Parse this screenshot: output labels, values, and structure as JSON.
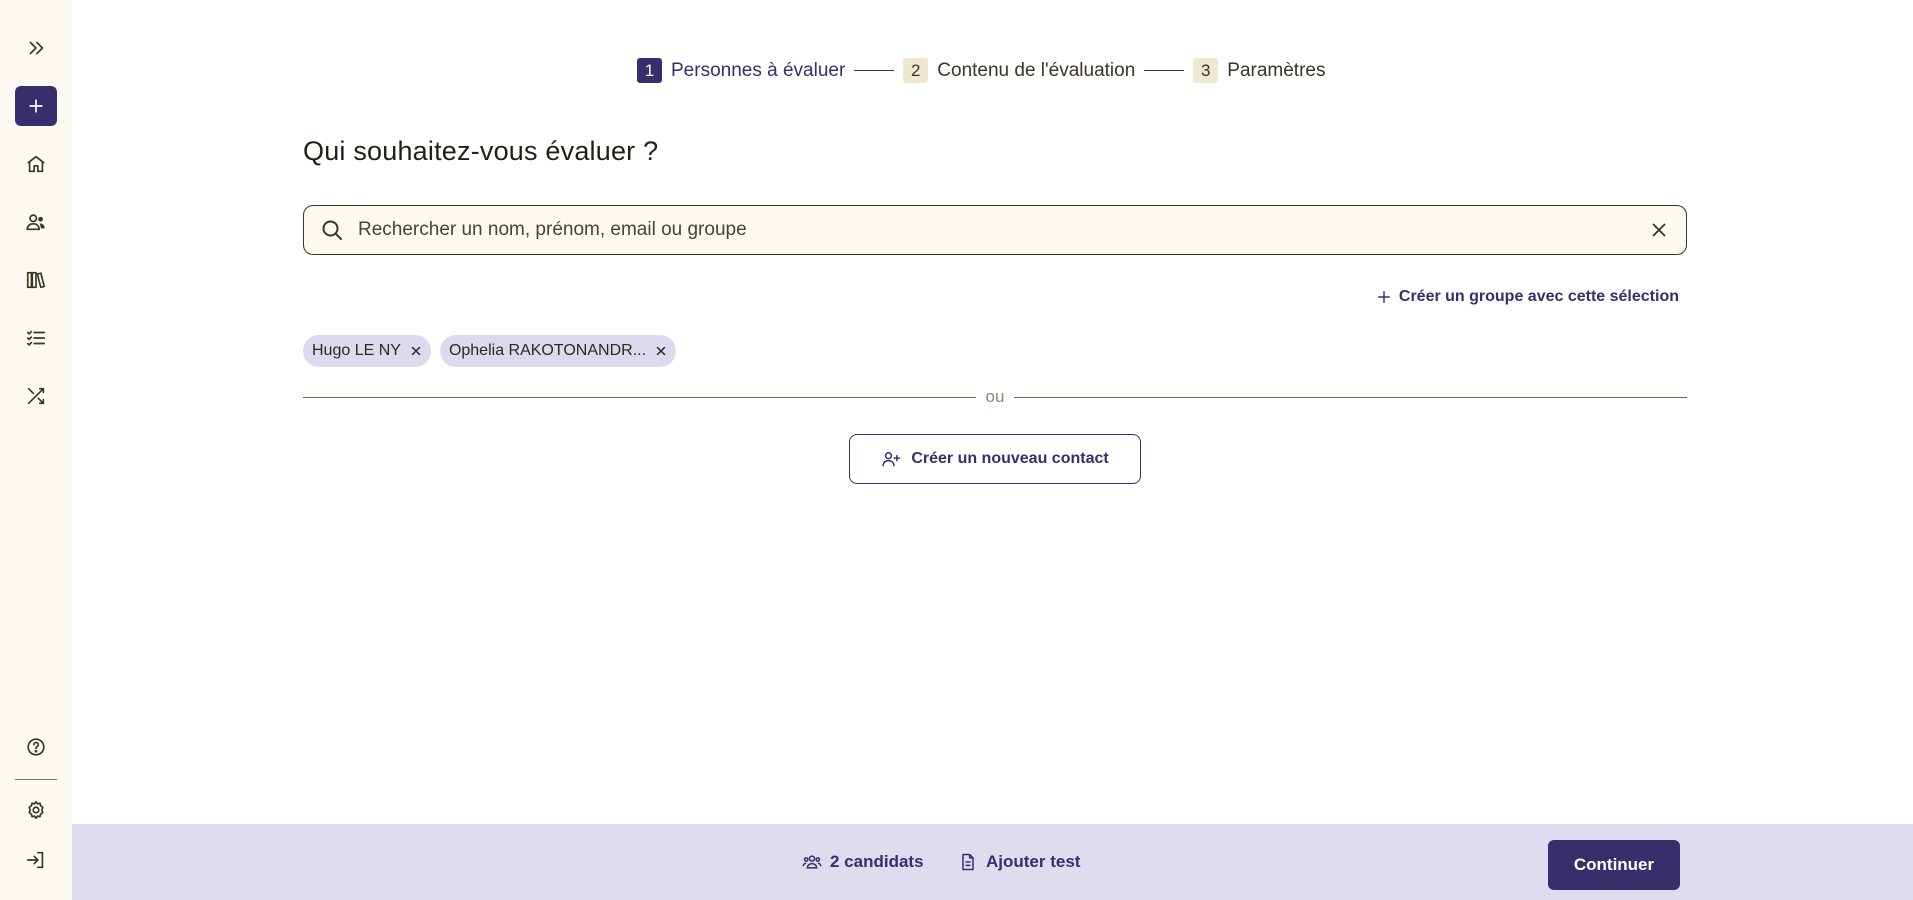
{
  "sidebar": {
    "icons": [
      "expand-icon",
      "plus-icon",
      "home-icon",
      "users-icon",
      "library-icon",
      "checklist-icon",
      "shuffle-icon",
      "help-icon",
      "gear-icon",
      "logout-icon"
    ]
  },
  "stepper": {
    "steps": [
      {
        "num": "1",
        "label": "Personnes à évaluer",
        "active": true
      },
      {
        "num": "2",
        "label": "Contenu de l'évaluation",
        "active": false
      },
      {
        "num": "3",
        "label": "Paramètres",
        "active": false
      }
    ]
  },
  "main": {
    "title": "Qui souhaitez-vous évaluer ?",
    "search": {
      "placeholder": "Rechercher un nom, prénom, email ou groupe",
      "value": ""
    },
    "create_group_label": "Créer un groupe avec cette sélection",
    "chips": [
      {
        "label": "Hugo LE NY"
      },
      {
        "label": "Ophelia RAKOTONANDR..."
      }
    ],
    "or_label": "ou",
    "new_contact_label": "Créer un nouveau contact"
  },
  "bottom_bar": {
    "candidates_label": "2 candidats",
    "add_test_label": "Ajouter test",
    "continue_label": "Continuer"
  },
  "colors": {
    "accent": "#3a2d6c",
    "sidebar_bg": "#fbf9f2",
    "chip_bg": "#ddd9ef",
    "bottom_bar_bg": "#dfdcf0",
    "step_inactive_bg": "#efe7cf"
  }
}
